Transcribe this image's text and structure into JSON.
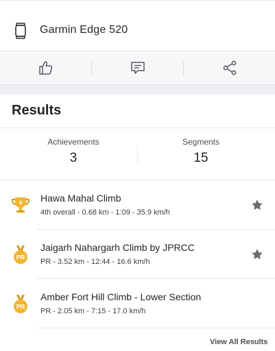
{
  "device": {
    "label": "Garmin Edge 520",
    "icon": "watch-icon"
  },
  "actions": [
    {
      "name": "kudos",
      "icon": "thumbs-up-icon"
    },
    {
      "name": "comment",
      "icon": "comment-icon"
    },
    {
      "name": "share",
      "icon": "share-icon"
    }
  ],
  "results": {
    "title": "Results",
    "stats": [
      {
        "label": "Achievements",
        "value": "3"
      },
      {
        "label": "Segments",
        "value": "15"
      }
    ],
    "segments": [
      {
        "name": "Hawa Mahal Climb",
        "stats": "4th overall - 0.68 km - 1:09 - 35.9 km/h",
        "badge": "trophy-icon",
        "badge_text": "4",
        "starred": true
      },
      {
        "name": "Jaigarh Nahargarh Climb by JPRCC",
        "stats": "PR - 3.52 km - 12:44 - 16.6 km/h",
        "badge": "pr-medal-icon",
        "badge_text": "PR",
        "starred": true
      },
      {
        "name": "Amber Fort Hill Climb - Lower Section",
        "stats": "PR - 2.05 km - 7:15 - 17.0 km/h",
        "badge": "pr-medal-icon",
        "badge_text": "PR",
        "starred": false
      }
    ],
    "view_all_label": "View All Results"
  },
  "colors": {
    "gold": "#f1b531",
    "gold_dark": "#d99a16",
    "icon_gray": "#56565c",
    "star": "#6b6b70"
  }
}
